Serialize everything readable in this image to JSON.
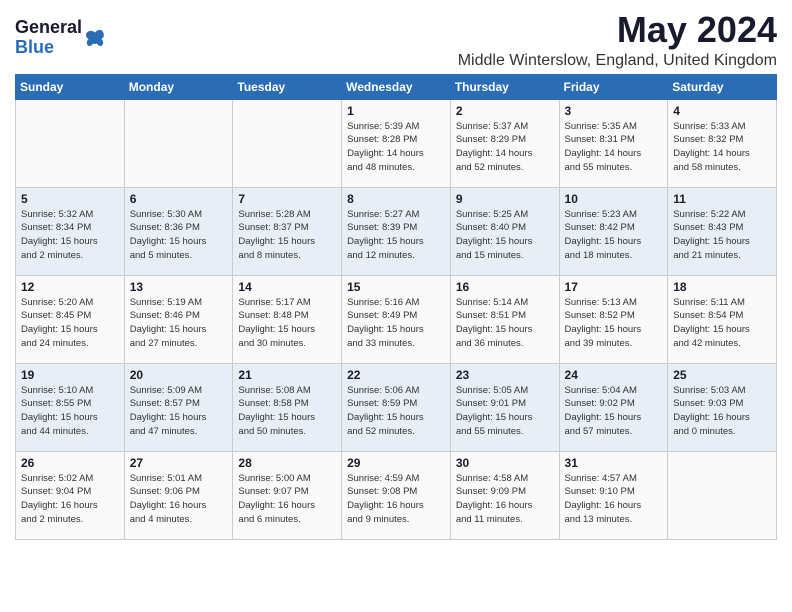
{
  "header": {
    "logo_general": "General",
    "logo_blue": "Blue",
    "title": "May 2024",
    "subtitle": "Middle Winterslow, England, United Kingdom"
  },
  "days_of_week": [
    "Sunday",
    "Monday",
    "Tuesday",
    "Wednesday",
    "Thursday",
    "Friday",
    "Saturday"
  ],
  "weeks": [
    [
      {
        "day": "",
        "info": ""
      },
      {
        "day": "",
        "info": ""
      },
      {
        "day": "",
        "info": ""
      },
      {
        "day": "1",
        "info": "Sunrise: 5:39 AM\nSunset: 8:28 PM\nDaylight: 14 hours\nand 48 minutes."
      },
      {
        "day": "2",
        "info": "Sunrise: 5:37 AM\nSunset: 8:29 PM\nDaylight: 14 hours\nand 52 minutes."
      },
      {
        "day": "3",
        "info": "Sunrise: 5:35 AM\nSunset: 8:31 PM\nDaylight: 14 hours\nand 55 minutes."
      },
      {
        "day": "4",
        "info": "Sunrise: 5:33 AM\nSunset: 8:32 PM\nDaylight: 14 hours\nand 58 minutes."
      }
    ],
    [
      {
        "day": "5",
        "info": "Sunrise: 5:32 AM\nSunset: 8:34 PM\nDaylight: 15 hours\nand 2 minutes."
      },
      {
        "day": "6",
        "info": "Sunrise: 5:30 AM\nSunset: 8:36 PM\nDaylight: 15 hours\nand 5 minutes."
      },
      {
        "day": "7",
        "info": "Sunrise: 5:28 AM\nSunset: 8:37 PM\nDaylight: 15 hours\nand 8 minutes."
      },
      {
        "day": "8",
        "info": "Sunrise: 5:27 AM\nSunset: 8:39 PM\nDaylight: 15 hours\nand 12 minutes."
      },
      {
        "day": "9",
        "info": "Sunrise: 5:25 AM\nSunset: 8:40 PM\nDaylight: 15 hours\nand 15 minutes."
      },
      {
        "day": "10",
        "info": "Sunrise: 5:23 AM\nSunset: 8:42 PM\nDaylight: 15 hours\nand 18 minutes."
      },
      {
        "day": "11",
        "info": "Sunrise: 5:22 AM\nSunset: 8:43 PM\nDaylight: 15 hours\nand 21 minutes."
      }
    ],
    [
      {
        "day": "12",
        "info": "Sunrise: 5:20 AM\nSunset: 8:45 PM\nDaylight: 15 hours\nand 24 minutes."
      },
      {
        "day": "13",
        "info": "Sunrise: 5:19 AM\nSunset: 8:46 PM\nDaylight: 15 hours\nand 27 minutes."
      },
      {
        "day": "14",
        "info": "Sunrise: 5:17 AM\nSunset: 8:48 PM\nDaylight: 15 hours\nand 30 minutes."
      },
      {
        "day": "15",
        "info": "Sunrise: 5:16 AM\nSunset: 8:49 PM\nDaylight: 15 hours\nand 33 minutes."
      },
      {
        "day": "16",
        "info": "Sunrise: 5:14 AM\nSunset: 8:51 PM\nDaylight: 15 hours\nand 36 minutes."
      },
      {
        "day": "17",
        "info": "Sunrise: 5:13 AM\nSunset: 8:52 PM\nDaylight: 15 hours\nand 39 minutes."
      },
      {
        "day": "18",
        "info": "Sunrise: 5:11 AM\nSunset: 8:54 PM\nDaylight: 15 hours\nand 42 minutes."
      }
    ],
    [
      {
        "day": "19",
        "info": "Sunrise: 5:10 AM\nSunset: 8:55 PM\nDaylight: 15 hours\nand 44 minutes."
      },
      {
        "day": "20",
        "info": "Sunrise: 5:09 AM\nSunset: 8:57 PM\nDaylight: 15 hours\nand 47 minutes."
      },
      {
        "day": "21",
        "info": "Sunrise: 5:08 AM\nSunset: 8:58 PM\nDaylight: 15 hours\nand 50 minutes."
      },
      {
        "day": "22",
        "info": "Sunrise: 5:06 AM\nSunset: 8:59 PM\nDaylight: 15 hours\nand 52 minutes."
      },
      {
        "day": "23",
        "info": "Sunrise: 5:05 AM\nSunset: 9:01 PM\nDaylight: 15 hours\nand 55 minutes."
      },
      {
        "day": "24",
        "info": "Sunrise: 5:04 AM\nSunset: 9:02 PM\nDaylight: 15 hours\nand 57 minutes."
      },
      {
        "day": "25",
        "info": "Sunrise: 5:03 AM\nSunset: 9:03 PM\nDaylight: 16 hours\nand 0 minutes."
      }
    ],
    [
      {
        "day": "26",
        "info": "Sunrise: 5:02 AM\nSunset: 9:04 PM\nDaylight: 16 hours\nand 2 minutes."
      },
      {
        "day": "27",
        "info": "Sunrise: 5:01 AM\nSunset: 9:06 PM\nDaylight: 16 hours\nand 4 minutes."
      },
      {
        "day": "28",
        "info": "Sunrise: 5:00 AM\nSunset: 9:07 PM\nDaylight: 16 hours\nand 6 minutes."
      },
      {
        "day": "29",
        "info": "Sunrise: 4:59 AM\nSunset: 9:08 PM\nDaylight: 16 hours\nand 9 minutes."
      },
      {
        "day": "30",
        "info": "Sunrise: 4:58 AM\nSunset: 9:09 PM\nDaylight: 16 hours\nand 11 minutes."
      },
      {
        "day": "31",
        "info": "Sunrise: 4:57 AM\nSunset: 9:10 PM\nDaylight: 16 hours\nand 13 minutes."
      },
      {
        "day": "",
        "info": ""
      }
    ]
  ]
}
